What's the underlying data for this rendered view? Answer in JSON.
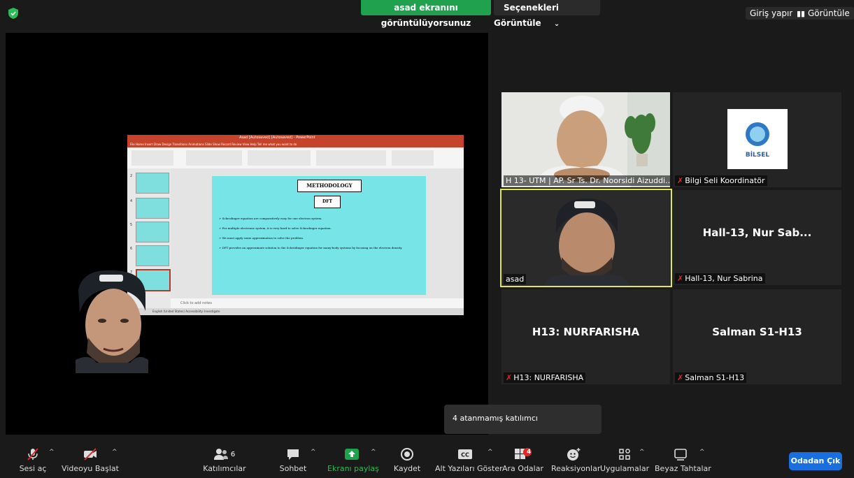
{
  "topbar": {
    "share_banner": "asad ekranını görüntülüyorsunuz",
    "view_options": "Seçenekleri Görüntüle",
    "view_options_chevron": "⌄",
    "sign_in": "Giriş yapın",
    "view_button": "Görüntüle"
  },
  "shared_screen": {
    "window_title": "Asad [Autosaved] [Autosaved] - PowerPoint",
    "ribbon_tabs": "File  Home  Insert  Draw  Design  Transitions  Animations  Slide Show  Record  Review  View  Help  Tell me what you want to do",
    "thumbnail_numbers": [
      "2",
      "4",
      "5",
      "6",
      "7"
    ],
    "slide": {
      "title": "METHODOLOGY",
      "subtitle": "DFT",
      "bullets": [
        "➢ Schrodinger equation are comparatively easy for one electron system.",
        "➢ For multiple electronic system, it is very hard to solve Schrodinger equation.",
        "➢ We must apply some approximation to solve the problem.",
        "➢ DFT provides an approximate solution to the Schrödinger equation for many-body systems by focusing on the electron density."
      ]
    },
    "notes_placeholder": "Click to add notes",
    "status_text": "English (United States)   Accessibility: Investigate"
  },
  "participants_tiles": [
    {
      "name": "H 13- UTM | AP. Sr Ts. Dr. Noorsidi Aizuddi...",
      "muted": false
    },
    {
      "name": "Bilgi Seli Koordinatör",
      "muted": true,
      "logo_text": "BİLSEL"
    },
    {
      "name": "asad",
      "muted": false,
      "active_speaker": true
    },
    {
      "name": "Hall-13, Nur Sabrina",
      "big_label": "Hall-13, Nur Sab...",
      "muted": true
    },
    {
      "name": "H13: NURFARISHA",
      "big_label": "H13: NURFARISHA",
      "muted": true
    },
    {
      "name": "Salman S1-H13",
      "big_label": "Salman S1-H13",
      "muted": true
    }
  ],
  "tooltip": "4 atanmamış katılımcı",
  "toolbar": {
    "unmute": "Sesi aç",
    "start_video": "Videoyu Başlat",
    "participants": "Katılımcılar",
    "participants_count": "6",
    "chat": "Sohbet",
    "share_screen": "Ekranı paylaş",
    "record": "Kaydet",
    "captions": "Alt Yazıları Göster",
    "breakout_rooms": "Ara Odalar",
    "breakout_badge": "4",
    "reactions": "Reaksiyonlar",
    "apps": "Uygulamalar",
    "whiteboards": "Beyaz Tahtalar",
    "leave": "Odadan Çık",
    "caret": "^"
  },
  "colors": {
    "share_green": "#1fa14e",
    "active_speaker_border": "#e2e84a",
    "leave_blue": "#1a6fe0",
    "muted_red": "#e02828",
    "ppt_red": "#c4432a",
    "slide_cyan": "#77e5e8"
  }
}
